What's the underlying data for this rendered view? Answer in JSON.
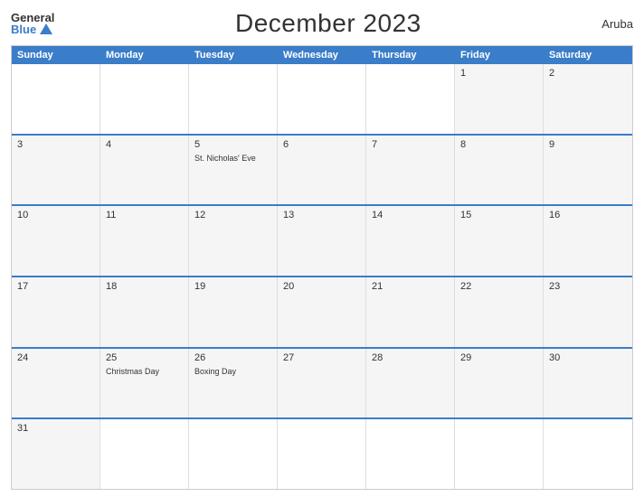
{
  "header": {
    "logo": {
      "general": "General",
      "blue": "Blue",
      "triangle": true
    },
    "title": "December 2023",
    "country": "Aruba"
  },
  "dayHeaders": [
    "Sunday",
    "Monday",
    "Tuesday",
    "Wednesday",
    "Thursday",
    "Friday",
    "Saturday"
  ],
  "weeks": [
    [
      {
        "day": "",
        "empty": true
      },
      {
        "day": "",
        "empty": true
      },
      {
        "day": "",
        "empty": true
      },
      {
        "day": "",
        "empty": true
      },
      {
        "day": "",
        "empty": true
      },
      {
        "day": "1",
        "holiday": ""
      },
      {
        "day": "2",
        "holiday": ""
      }
    ],
    [
      {
        "day": "3",
        "holiday": ""
      },
      {
        "day": "4",
        "holiday": ""
      },
      {
        "day": "5",
        "holiday": "St. Nicholas' Eve"
      },
      {
        "day": "6",
        "holiday": ""
      },
      {
        "day": "7",
        "holiday": ""
      },
      {
        "day": "8",
        "holiday": ""
      },
      {
        "day": "9",
        "holiday": ""
      }
    ],
    [
      {
        "day": "10",
        "holiday": ""
      },
      {
        "day": "11",
        "holiday": ""
      },
      {
        "day": "12",
        "holiday": ""
      },
      {
        "day": "13",
        "holiday": ""
      },
      {
        "day": "14",
        "holiday": ""
      },
      {
        "day": "15",
        "holiday": ""
      },
      {
        "day": "16",
        "holiday": ""
      }
    ],
    [
      {
        "day": "17",
        "holiday": ""
      },
      {
        "day": "18",
        "holiday": ""
      },
      {
        "day": "19",
        "holiday": ""
      },
      {
        "day": "20",
        "holiday": ""
      },
      {
        "day": "21",
        "holiday": ""
      },
      {
        "day": "22",
        "holiday": ""
      },
      {
        "day": "23",
        "holiday": ""
      }
    ],
    [
      {
        "day": "24",
        "holiday": ""
      },
      {
        "day": "25",
        "holiday": "Christmas Day"
      },
      {
        "day": "26",
        "holiday": "Boxing Day"
      },
      {
        "day": "27",
        "holiday": ""
      },
      {
        "day": "28",
        "holiday": ""
      },
      {
        "day": "29",
        "holiday": ""
      },
      {
        "day": "30",
        "holiday": ""
      }
    ],
    [
      {
        "day": "31",
        "holiday": ""
      },
      {
        "day": "",
        "empty": true
      },
      {
        "day": "",
        "empty": true
      },
      {
        "day": "",
        "empty": true
      },
      {
        "day": "",
        "empty": true
      },
      {
        "day": "",
        "empty": true
      },
      {
        "day": "",
        "empty": true
      }
    ]
  ]
}
